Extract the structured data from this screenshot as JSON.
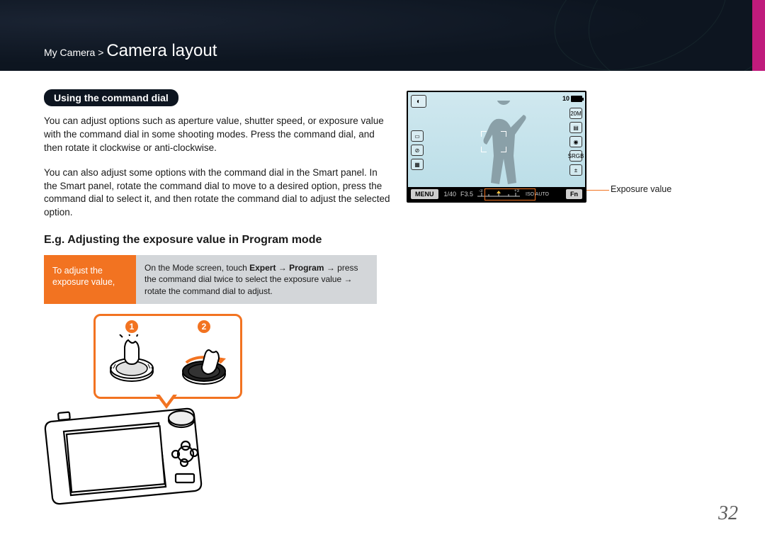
{
  "breadcrumb": {
    "path": "My Camera > ",
    "title": "Camera layout"
  },
  "section_pill": "Using the command dial",
  "para1": "You can adjust options such as aperture value, shutter speed, or exposure value with the command dial in some shooting modes. Press the command dial, and then rotate it clockwise or anti-clockwise.",
  "para2": "You can also adjust some options with the command dial in the Smart panel. In the Smart panel, rotate the command dial to move to a desired option, press the command dial to select it, and then rotate the command dial to adjust the selected option.",
  "subheading": "E.g. Adjusting the exposure value in Program mode",
  "instruction": {
    "left": "To adjust the exposure value,",
    "right_pre": "On the Mode screen, touch ",
    "right_b1": "Expert",
    "right_arrow": " → ",
    "right_b2": "Program",
    "right_post": " → press the command dial twice to select the exposure value → rotate the command dial to adjust."
  },
  "callout": {
    "n1": "1",
    "n2": "2"
  },
  "screen": {
    "menu": "MENU",
    "fn": "Fn",
    "shutter": "1/40",
    "aperture": "F3.5",
    "iso": "ISO AUTO",
    "count": "10",
    "callout_label": "Exposure value"
  },
  "page_number": "32"
}
